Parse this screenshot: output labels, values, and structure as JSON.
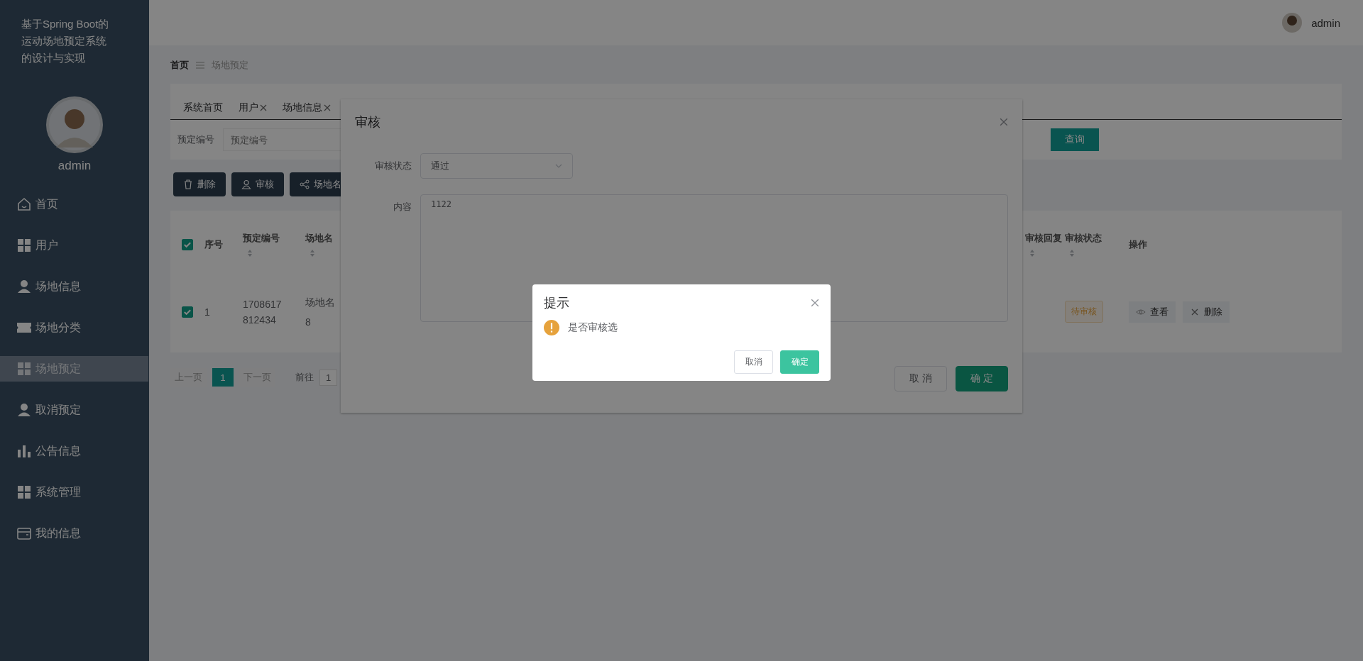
{
  "sidebar": {
    "title": "基于Spring Boot的运动场地预定系统的设计与实现",
    "user": "admin",
    "items": [
      {
        "label": "首页",
        "kind": "home",
        "selected": false
      },
      {
        "label": "用户",
        "kind": "grid",
        "selected": false
      },
      {
        "label": "场地信息",
        "kind": "person",
        "selected": false
      },
      {
        "label": "场地分类",
        "kind": "ticket",
        "selected": false
      },
      {
        "label": "场地预定",
        "kind": "grid",
        "selected": true
      },
      {
        "label": "取消预定",
        "kind": "person",
        "selected": false
      },
      {
        "label": "公告信息",
        "kind": "chart",
        "selected": false
      },
      {
        "label": "系统管理",
        "kind": "grid",
        "selected": false
      },
      {
        "label": "我的信息",
        "kind": "card",
        "selected": false
      }
    ]
  },
  "topbar": {
    "user": "admin"
  },
  "breadcrumb": [
    "首页",
    "场地预定"
  ],
  "tabs": [
    {
      "label": "系统首页",
      "closable": false
    },
    {
      "label": "用户",
      "closable": true
    },
    {
      "label": "场地信息",
      "closable": true
    }
  ],
  "search": {
    "label": "预定编号",
    "placeholder": "预定编号",
    "button": "查询"
  },
  "actions": [
    {
      "label": "删除",
      "kind": "trash"
    },
    {
      "label": "审核",
      "kind": "user"
    },
    {
      "label": "场地名",
      "kind": "share"
    }
  ],
  "table": {
    "header_checked": true,
    "columns": [
      {
        "label": "序号",
        "sortable": false
      },
      {
        "label": "预定编号",
        "sortable": true
      },
      {
        "label": "场地名",
        "sortable": true
      },
      {
        "label": "审核回复",
        "sortable": true
      },
      {
        "label": "审核状态",
        "sortable": true
      },
      {
        "label": "操作",
        "sortable": false
      }
    ],
    "rows": [
      {
        "checked": true,
        "index": "1",
        "number": "1708617812434",
        "name": [
          "场地名",
          "8"
        ],
        "status": {
          "label": "待审核",
          "kind": "pending"
        },
        "ops": [
          {
            "label": "查看",
            "kind": "view"
          },
          {
            "label": "删除",
            "kind": "delete"
          }
        ]
      }
    ]
  },
  "pagination": {
    "prev": "上一页",
    "pages": [
      {
        "label": "1",
        "selected": true
      }
    ],
    "next": "下一页",
    "goto": "前往",
    "page": "1"
  },
  "dialog": {
    "title": "审核",
    "fields": [
      {
        "label": "审核状态",
        "kind": "select",
        "value": "通过"
      },
      {
        "label": "内容",
        "kind": "textarea",
        "value": "1122"
      }
    ],
    "buttons": [
      {
        "label": "取 消",
        "kind": "default"
      },
      {
        "label": "确 定",
        "kind": "primary"
      }
    ]
  },
  "confirm": {
    "title": "提示",
    "message": "是否审核选",
    "buttons": [
      {
        "label": "取消",
        "kind": "default"
      },
      {
        "label": "确定",
        "kind": "primary"
      }
    ]
  }
}
